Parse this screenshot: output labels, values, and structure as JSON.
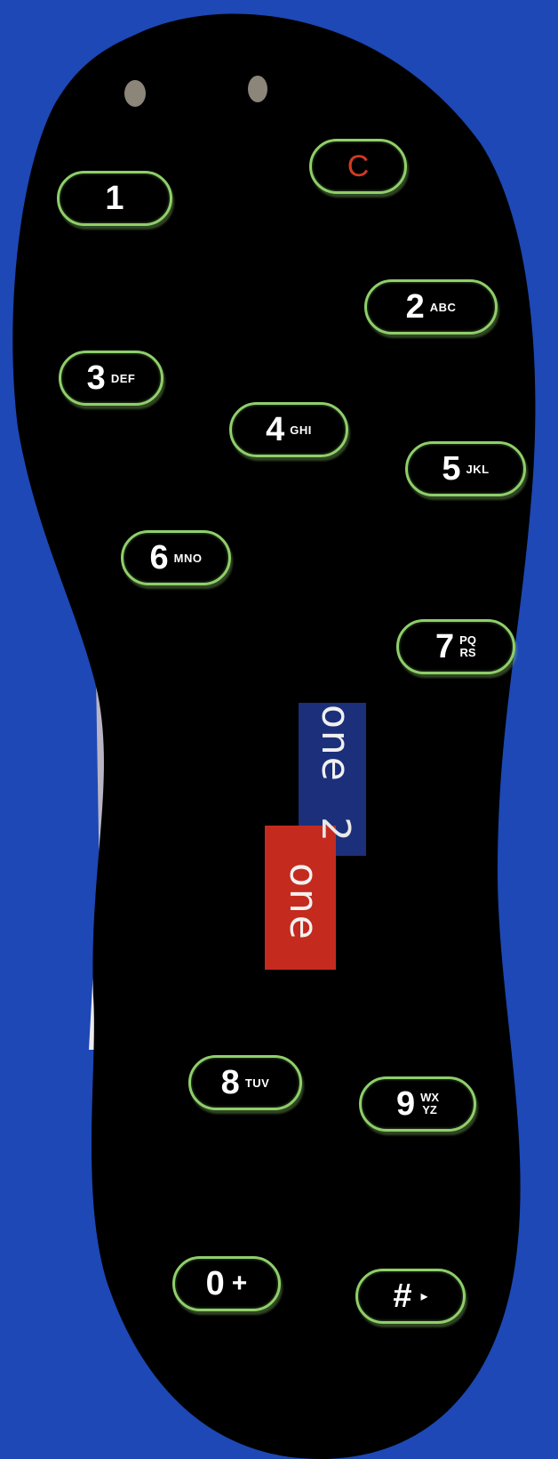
{
  "keys": [
    {
      "id": "1",
      "number": "1",
      "letters": ""
    },
    {
      "id": "clear",
      "number": "C",
      "letters": ""
    },
    {
      "id": "2",
      "number": "2",
      "letters": "ABC"
    },
    {
      "id": "3",
      "number": "3",
      "letters": "DEF"
    },
    {
      "id": "4",
      "number": "4",
      "letters": "GHI"
    },
    {
      "id": "5",
      "number": "5",
      "letters": "JKL"
    },
    {
      "id": "6",
      "number": "6",
      "letters": "MNO"
    },
    {
      "id": "7",
      "number": "7",
      "letters_top": "PQ",
      "letters_bottom": "RS"
    },
    {
      "id": "8",
      "number": "8",
      "letters": "TUV"
    },
    {
      "id": "9",
      "number": "9",
      "letters_top": "WX",
      "letters_bottom": "YZ"
    },
    {
      "id": "0",
      "number": "0",
      "symbol": "+"
    },
    {
      "id": "hash",
      "number": "#",
      "arrow": "▸"
    }
  ],
  "logo": {
    "part1": "one",
    "part2": "2",
    "part3": "one"
  },
  "colors": {
    "background": "#1d48b5",
    "sole": "#000000",
    "key_outline": "#8fcf6a",
    "clear_key_text": "#d43a22",
    "logo_blue": "#1c2f7a",
    "logo_red": "#c42a1e"
  }
}
